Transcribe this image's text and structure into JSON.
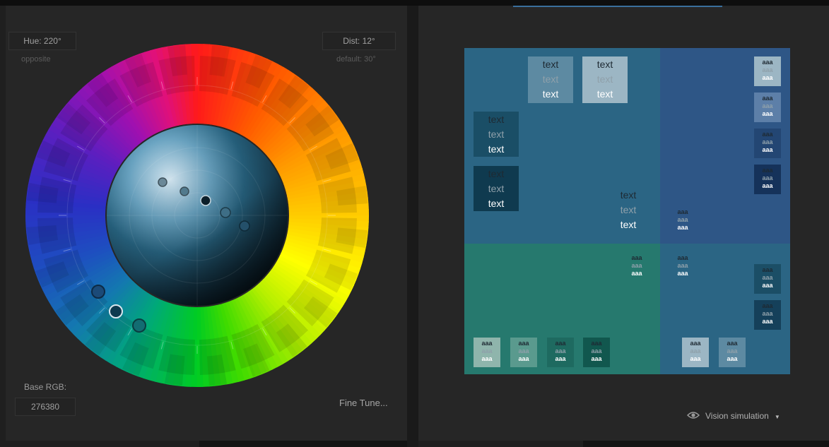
{
  "controls": {
    "hue_label": "Hue: 220°",
    "hue_hint": "opposite",
    "dist_label": "Dist: 12°",
    "dist_hint": "default: 30°",
    "base_rgb_label": "Base RGB:",
    "base_rgb_value": "276380",
    "fine_tune_label": "Fine Tune..."
  },
  "vision_simulation": {
    "label": "Vision simulation"
  },
  "preview": {
    "big_text": [
      "text",
      "text",
      "text"
    ],
    "small_text": [
      "aaa",
      "aaa",
      "aaa"
    ]
  },
  "colors": {
    "base": "#276380",
    "quadrant_top_left": "#276380",
    "quadrant_top_right": "#2c5788",
    "quadrant_bottom_left": "#237a74",
    "quadrant_bottom_right": "#276380"
  },
  "icons": [
    "eye-icon",
    "dropdown-caret-icon"
  ]
}
